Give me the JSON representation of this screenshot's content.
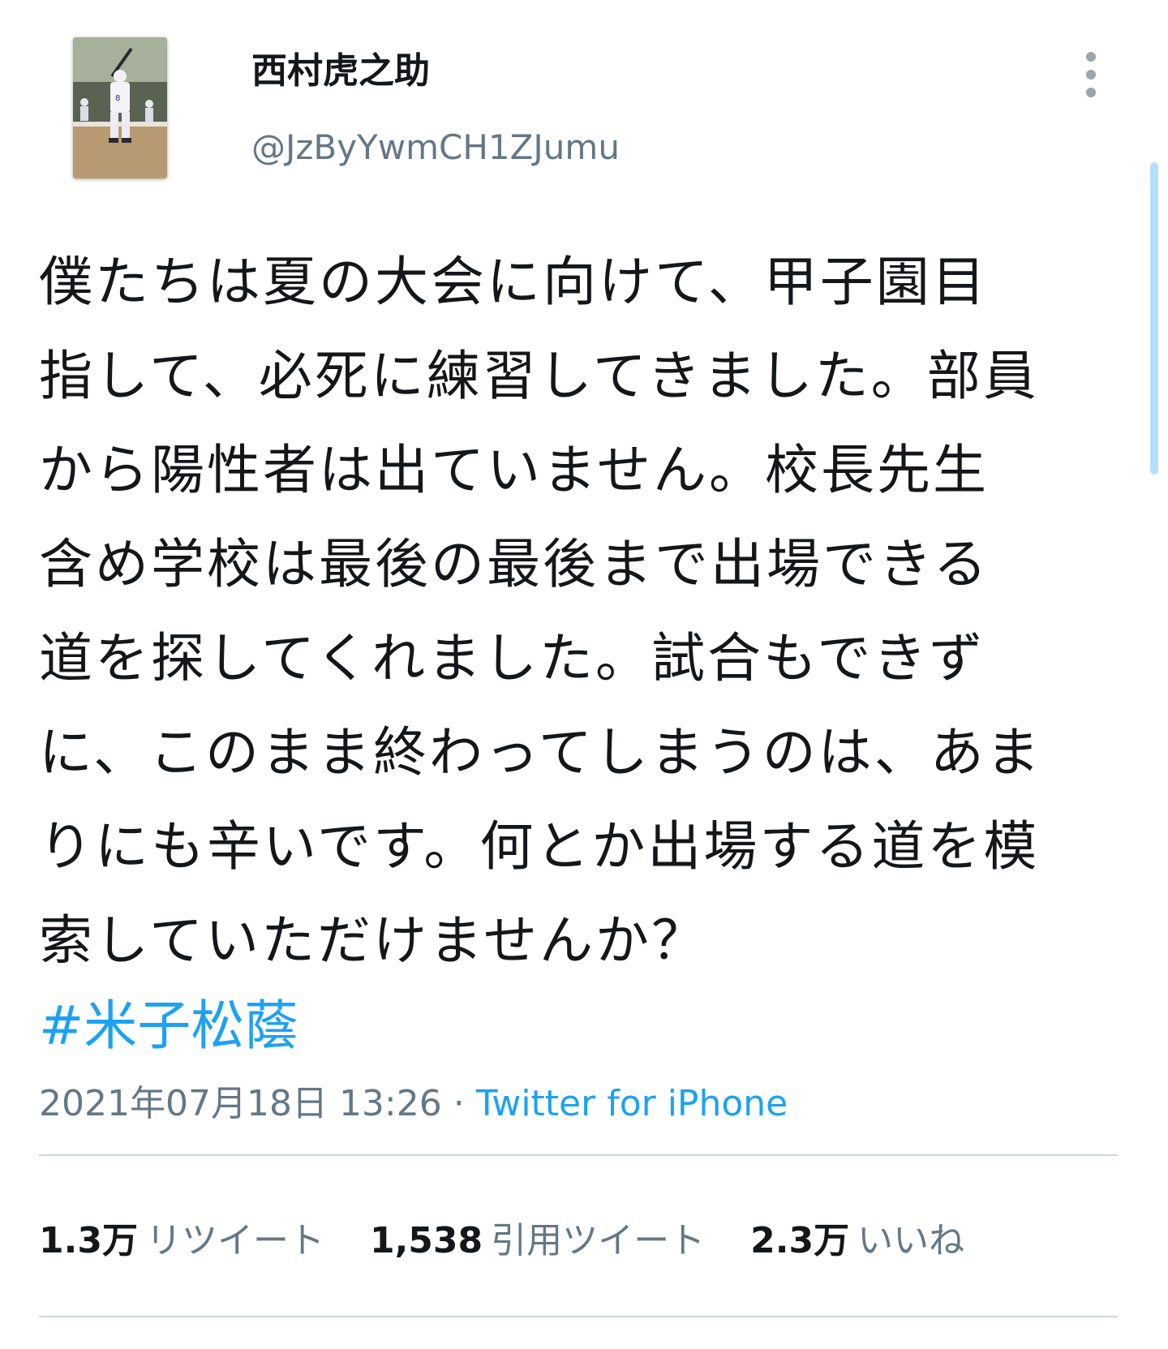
{
  "author": {
    "display_name": "西村虎之助",
    "handle": "@JzByYwmCH1ZJumu",
    "avatar_icon": "baseball-batter-photo"
  },
  "menu": {
    "icon": "more-vertical-icon"
  },
  "tweet": {
    "text": "僕たちは夏の大会に向けて、甲子園目\n指して、必死に練習してきました。部員\nから陽性者は出ていません。校長先生\n含め学校は最後の最後まで出場できる\n道を探してくれました。試合もできず\nに、このまま終わってしまうのは、あま\nりにも辛いです。何とか出場する道を模\n索していただけませんか？",
    "hashtag": "#米子松蔭",
    "timestamp": "2021年07月18日 13:26",
    "separator": "·",
    "source": "Twitter for iPhone"
  },
  "stats": {
    "retweets_count": "1.3万",
    "retweets_label": "リツイート",
    "quotes_count": "1,538",
    "quotes_label": "引用ツイート",
    "likes_count": "2.3万",
    "likes_label": "いいね"
  },
  "colors": {
    "link_blue": "#1da1f2",
    "secondary_gray": "#657786",
    "text": "#14171a",
    "divider": "#cfd6db"
  }
}
